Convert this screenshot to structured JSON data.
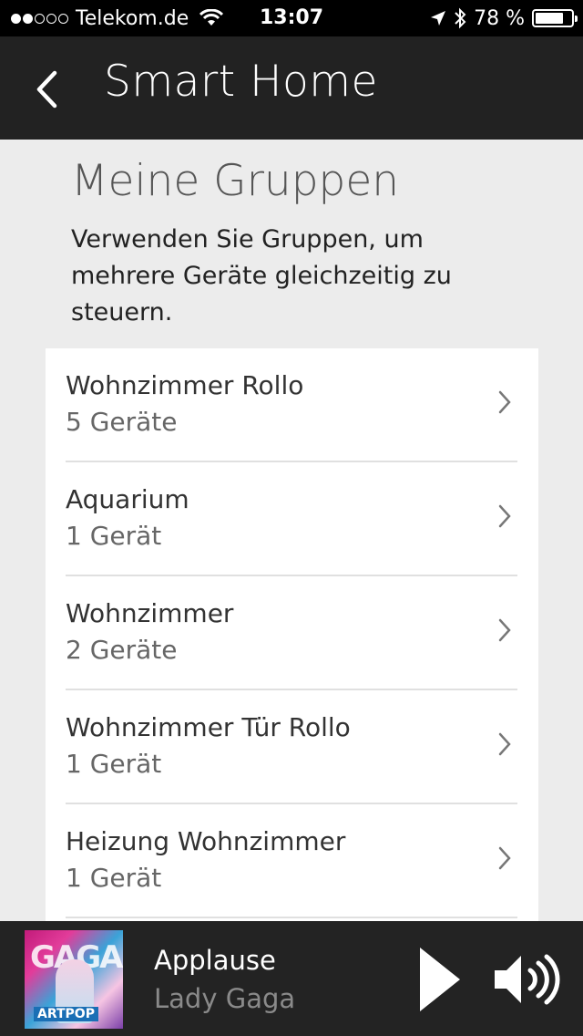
{
  "status_bar": {
    "carrier": "Telekom.de",
    "time": "13:07",
    "battery": "78 %",
    "battery_level": 0.78,
    "signal_bars": 2
  },
  "nav": {
    "title": "Smart Home",
    "back_icon": "chevron-left-icon"
  },
  "section": {
    "title": "Meine Gruppen",
    "description": "Verwenden Sie Gruppen, um mehrere Geräte gleichzeitig zu steuern."
  },
  "groups": [
    {
      "name": "Wohnzimmer Rollo",
      "count": "5 Geräte"
    },
    {
      "name": "Aquarium",
      "count": "1 Gerät"
    },
    {
      "name": "Wohnzimmer",
      "count": "2 Geräte"
    },
    {
      "name": "Wohnzimmer Tür Rollo",
      "count": "1 Gerät"
    },
    {
      "name": "Heizung Wohnzimmer",
      "count": "1 Gerät"
    }
  ],
  "player": {
    "track_title": "Applause",
    "artist": "Lady Gaga",
    "album_art_text": "GAGA",
    "album_label": "ARTPOP",
    "play_icon": "play-icon",
    "volume_icon": "volume-icon"
  },
  "colors": {
    "nav_background": "#222222",
    "content_background": "#ececec",
    "player_background": "#232323"
  }
}
